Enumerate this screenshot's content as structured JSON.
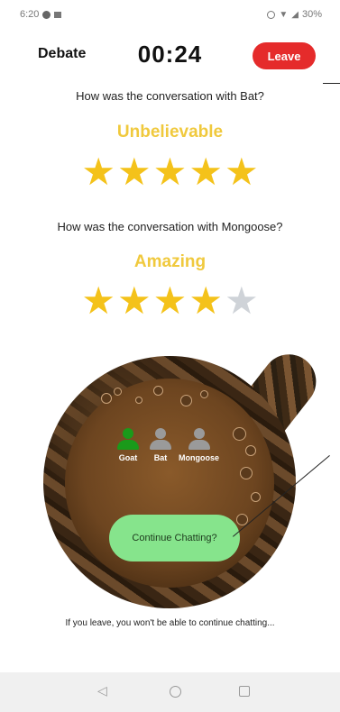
{
  "status_bar": {
    "time": "6:20",
    "battery": "30%"
  },
  "header": {
    "title": "Debate",
    "timer": "00:24",
    "leave_label": "Leave"
  },
  "ratings": [
    {
      "question": "How was the conversation with Bat?",
      "word": "Unbelievable",
      "stars": 5,
      "max_stars": 5
    },
    {
      "question": "How was the conversation with Mongoose?",
      "word": "Amazing",
      "stars": 4,
      "max_stars": 5
    }
  ],
  "participants": [
    {
      "name": "Goat",
      "color": "#1a9a1a"
    },
    {
      "name": "Bat",
      "color": "#9a9a9a"
    },
    {
      "name": "Mongoose",
      "color": "#9a9a9a"
    }
  ],
  "continue_label": "Continue Chatting?",
  "warning": "If you leave, you won't be able to continue chatting..."
}
